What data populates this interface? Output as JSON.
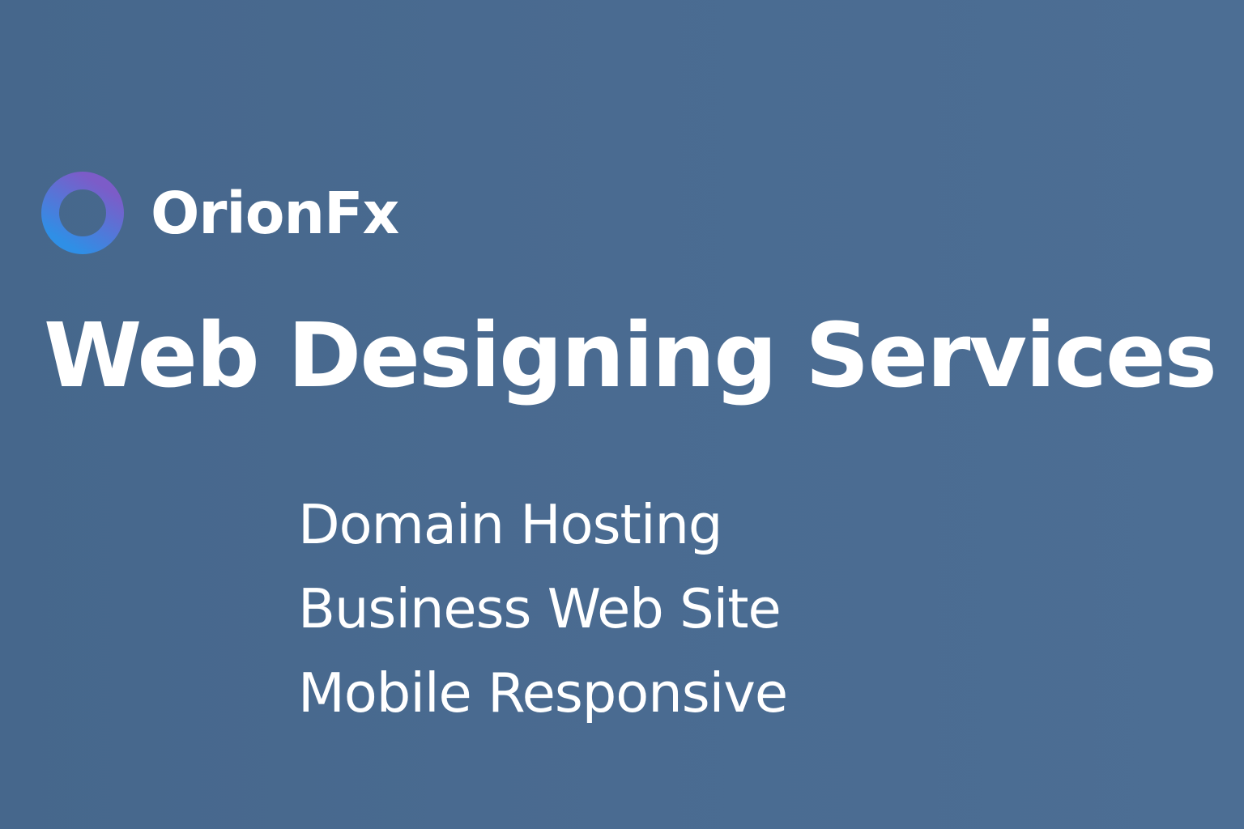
{
  "brand": {
    "name": "OrionFx",
    "logo_icon": "ring-icon",
    "logo_colors": [
      "#7c5cc8",
      "#2f8fe6"
    ]
  },
  "headline": "Web Designing Services",
  "services": [
    "Domain Hosting",
    "Business Web Site",
    "Mobile Responsive"
  ],
  "colors": {
    "background": "#4a6b8f",
    "text": "#ffffff"
  }
}
